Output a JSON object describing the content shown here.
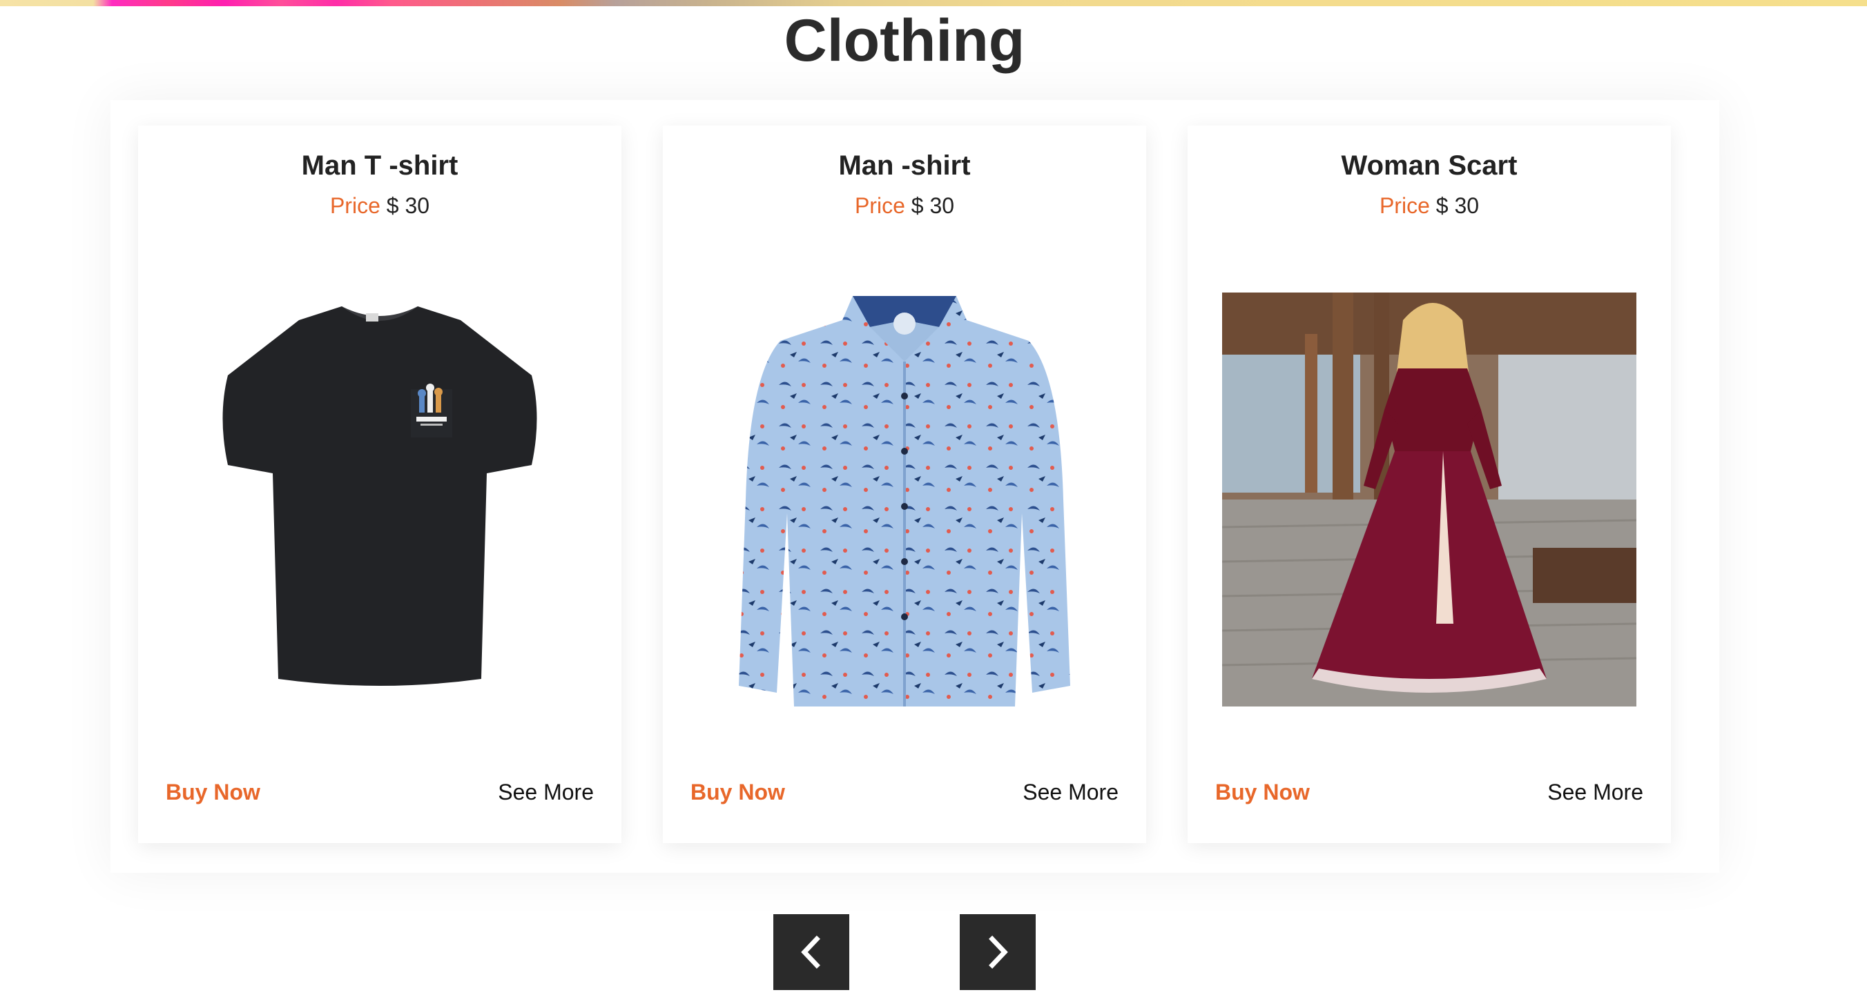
{
  "section": {
    "title": "Clothing"
  },
  "products": [
    {
      "name": "Man T -shirt",
      "price_label": "Price",
      "price_value": "$ 30",
      "image_icon": "black-tshirt-image",
      "buy_label": "Buy Now",
      "more_label": "See More"
    },
    {
      "name": "Man -shirt",
      "price_label": "Price",
      "price_value": "$ 30",
      "image_icon": "patterned-shirt-image",
      "buy_label": "Buy Now",
      "more_label": "See More"
    },
    {
      "name": "Woman Scart",
      "price_label": "Price",
      "price_value": "$ 30",
      "image_icon": "velvet-dress-photo",
      "buy_label": "Buy Now",
      "more_label": "See More"
    }
  ],
  "carousel": {
    "prev_icon": "chevron-left-icon",
    "next_icon": "chevron-right-icon"
  },
  "colors": {
    "accent": "#e8672a",
    "heading": "#2b2b2b",
    "nav_button": "#2a2a2a"
  }
}
